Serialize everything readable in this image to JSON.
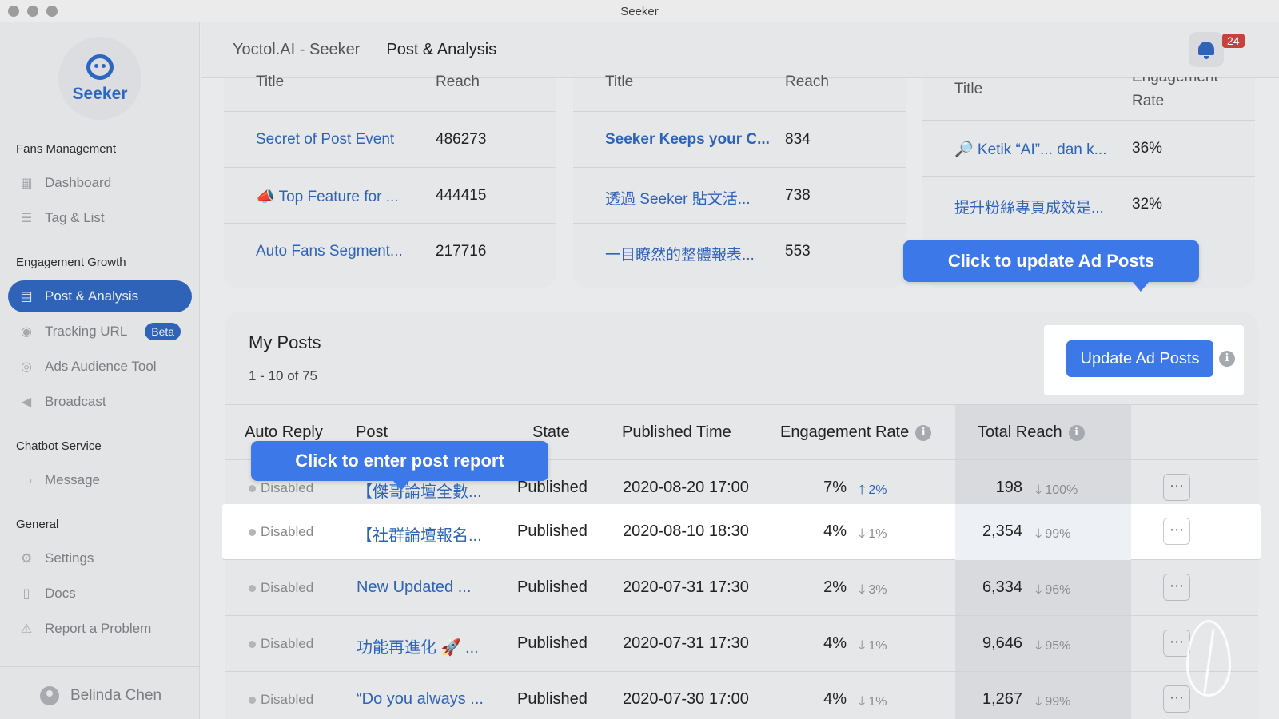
{
  "window": {
    "title": "Seeker"
  },
  "brand": {
    "logo_text": "Seeker",
    "accent": "#2f63b7"
  },
  "sidebar": {
    "sections": [
      {
        "title": "Fans Management",
        "items": [
          {
            "label": "Dashboard",
            "icon": "dashboard-icon"
          },
          {
            "label": "Tag & List",
            "icon": "tag-list-icon"
          }
        ]
      },
      {
        "title": "Engagement Growth",
        "items": [
          {
            "label": "Post & Analysis",
            "icon": "post-analysis-icon",
            "active": true
          },
          {
            "label": "Tracking URL",
            "icon": "eye-icon",
            "badge": "Beta"
          },
          {
            "label": "Ads Audience Tool",
            "icon": "target-icon"
          },
          {
            "label": "Broadcast",
            "icon": "megaphone-icon"
          }
        ]
      },
      {
        "title": "Chatbot Service",
        "items": [
          {
            "label": "Message",
            "icon": "chat-icon"
          }
        ]
      },
      {
        "title": "General",
        "items": [
          {
            "label": "Settings",
            "icon": "gear-icon"
          },
          {
            "label": "Docs",
            "icon": "docs-icon"
          },
          {
            "label": "Report a Problem",
            "icon": "alert-icon"
          }
        ]
      }
    ],
    "user": {
      "name": "Belinda Chen"
    }
  },
  "header": {
    "app_name": "Yoctol.AI - Seeker",
    "page_title": "Post & Analysis",
    "notification_count": "24"
  },
  "top_cards": [
    {
      "col1": "Title",
      "col2": "Reach",
      "rows": [
        {
          "title": "Secret of Post Event",
          "value": "486273"
        },
        {
          "title": "📣 Top Feature for ...",
          "value": "444415"
        },
        {
          "title": "Auto Fans Segment...",
          "value": "217716"
        }
      ]
    },
    {
      "col1": "Title",
      "col2": "Reach",
      "rows": [
        {
          "title": "Seeker Keeps your C...",
          "value": "834"
        },
        {
          "title": "透過 Seeker 貼文活...",
          "value": "738"
        },
        {
          "title": "一目瞭然的整體報表...",
          "value": "553"
        }
      ]
    },
    {
      "col1": "Title",
      "col2_top": "Engagement",
      "col2": "Rate",
      "rows": [
        {
          "title": "🔎 Ketik “AI”... dan k...",
          "value": "36%"
        },
        {
          "title": "提升粉絲專頁成效是...",
          "value": "32%"
        }
      ]
    }
  ],
  "tooltips": {
    "update_ad": "Click to update Ad Posts",
    "enter_report": "Click to enter post report"
  },
  "my_posts": {
    "title": "My Posts",
    "range": "1 - 10 of 75",
    "update_button": "Update Ad Posts",
    "columns": {
      "auto_reply": "Auto Reply",
      "post": "Post",
      "state": "State",
      "published_time": "Published Time",
      "engagement_rate": "Engagement Rate",
      "total_reach": "Total Reach"
    },
    "rows": [
      {
        "auto_reply": "Disabled",
        "post": "【傑哥論壇全數...",
        "state": "Published",
        "time": "2020-08-20 17:00",
        "er": "7%",
        "er_delta": "2%",
        "er_dir": "up",
        "reach": "198",
        "reach_delta": "100%",
        "reach_dir": "down"
      },
      {
        "auto_reply": "Disabled",
        "post": "【社群論壇報名...",
        "state": "Published",
        "time": "2020-08-10 18:30",
        "er": "4%",
        "er_delta": "1%",
        "er_dir": "down",
        "reach": "2,354",
        "reach_delta": "99%",
        "reach_dir": "down",
        "highlight": true
      },
      {
        "auto_reply": "Disabled",
        "post": "New Updated ...",
        "state": "Published",
        "time": "2020-07-31 17:30",
        "er": "2%",
        "er_delta": "3%",
        "er_dir": "down",
        "reach": "6,334",
        "reach_delta": "96%",
        "reach_dir": "down"
      },
      {
        "auto_reply": "Disabled",
        "post": "功能再進化 🚀 ...",
        "state": "Published",
        "time": "2020-07-31 17:30",
        "er": "4%",
        "er_delta": "1%",
        "er_dir": "down",
        "reach": "9,646",
        "reach_delta": "95%",
        "reach_dir": "down"
      },
      {
        "auto_reply": "Disabled",
        "post": "“Do you always ...",
        "state": "Published",
        "time": "2020-07-30 17:00",
        "er": "4%",
        "er_delta": "1%",
        "er_dir": "down",
        "reach": "1,267",
        "reach_delta": "99%",
        "reach_dir": "down"
      }
    ]
  }
}
